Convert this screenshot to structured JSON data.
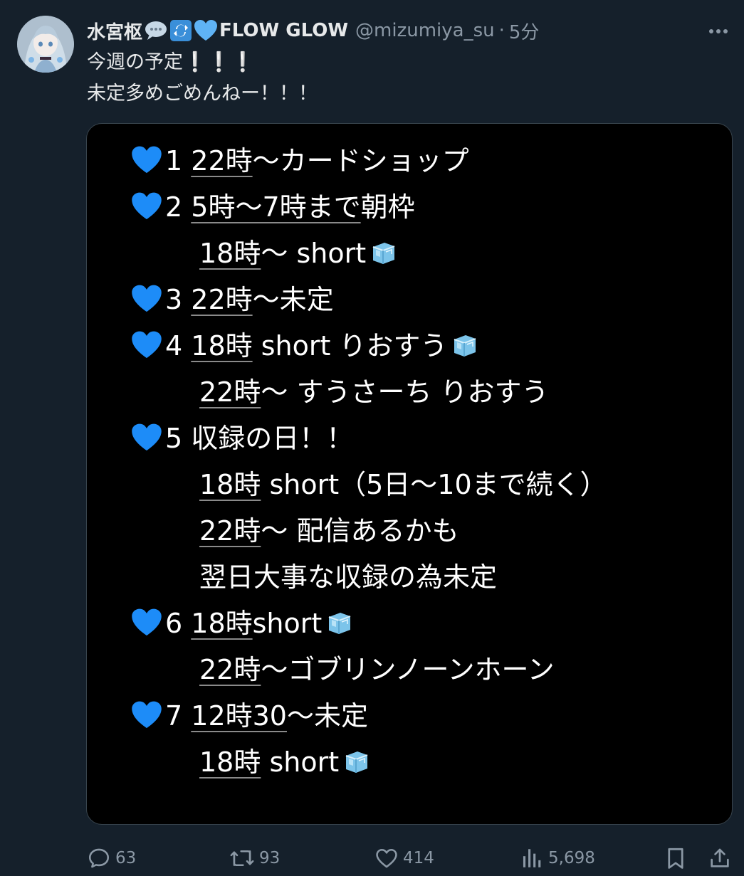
{
  "tweet": {
    "display_name": "水宮枢",
    "brand": "FLOW GLOW",
    "handle": "@mizumiya_su",
    "separator": "·",
    "time": "5分",
    "text_lines": [
      "今週の予定❕❕❕",
      "未定多めごめんねー！！！"
    ]
  },
  "schedule": {
    "lines": [
      {
        "prefix": "1 ",
        "underlined": "22時",
        "rest": "〜カードショップ",
        "ice": false
      },
      {
        "prefix": "2 ",
        "underlined": "5時〜7時まで",
        "rest": "朝枠",
        "ice": false
      },
      {
        "prefix": "",
        "underlined": "18時",
        "rest": "〜 short",
        "ice": true
      },
      {
        "prefix": "3 ",
        "underlined": "22時",
        "rest": "〜未定",
        "ice": false
      },
      {
        "prefix": "4 ",
        "underlined": "18時",
        "rest": " short りおすう",
        "ice": true
      },
      {
        "prefix": "",
        "underlined": "22時",
        "rest": "〜 すうさーち りおすう",
        "ice": false
      },
      {
        "prefix": "5 ",
        "underlined": "",
        "rest": "収録の日！！",
        "ice": false
      },
      {
        "prefix": "",
        "underlined": "18時",
        "rest": " short（5日〜10まで続く）",
        "ice": false
      },
      {
        "prefix": "",
        "underlined": "22時",
        "rest": "〜 配信あるかも",
        "ice": false
      },
      {
        "prefix": "",
        "underlined": "",
        "rest": "翌日大事な収録の為未定",
        "ice": false
      },
      {
        "prefix": "6 ",
        "underlined": "18時",
        "rest": "short",
        "ice": true
      },
      {
        "prefix": "",
        "underlined": "22時",
        "rest": "〜ゴブリンノーンホーン",
        "ice": false
      },
      {
        "prefix": "7 ",
        "underlined": "12時30",
        "rest": "〜未定",
        "ice": false
      },
      {
        "prefix": "",
        "underlined": "18時",
        "rest": " short",
        "ice": true
      }
    ]
  },
  "actions": {
    "replies": "63",
    "retweets": "93",
    "likes": "414",
    "views": "5,698"
  },
  "icons": {
    "speech": "speech-bubble-emoji-icon",
    "repeat": "repeat-button-emoji-icon",
    "heart": "blue-heart-icon",
    "ice": "ice-cube-icon"
  },
  "colors": {
    "background": "#15202b",
    "text": "#e7e9ea",
    "muted": "#8b98a5",
    "heart": "#1d8cf8",
    "media_bg": "#000000"
  }
}
